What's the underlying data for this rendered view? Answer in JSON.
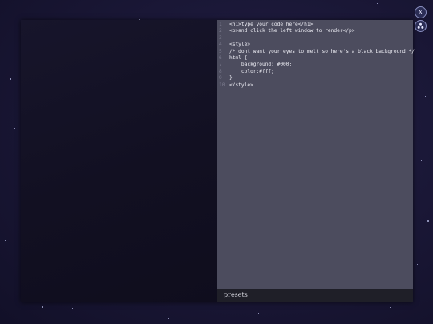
{
  "editor": {
    "lines": [
      {
        "num": "1",
        "text": "<h1>type your code here</h1>"
      },
      {
        "num": "2",
        "text": "<p>and click the left window to render</p>"
      },
      {
        "num": "3",
        "text": ""
      },
      {
        "num": "4",
        "text": "<style>"
      },
      {
        "num": "5",
        "text": "/* dont want your eyes to melt so here's a black background */"
      },
      {
        "num": "6",
        "text": "html {"
      },
      {
        "num": "7",
        "text": "    background: #000;"
      },
      {
        "num": "8",
        "text": "    color:#fff;"
      },
      {
        "num": "9",
        "text": "}"
      },
      {
        "num": "10",
        "text": "</style>"
      }
    ]
  },
  "presets": {
    "label": "presets"
  },
  "controls": {
    "close_label": "X"
  },
  "colors": {
    "editor_bg": "#4c4c5e",
    "preview_bg": "#121022",
    "presets_bar_bg": "#1f1f28",
    "button_bg": "#2b2d55"
  },
  "icons": {
    "close": "close-icon",
    "settings": "tri-dot-icon"
  }
}
